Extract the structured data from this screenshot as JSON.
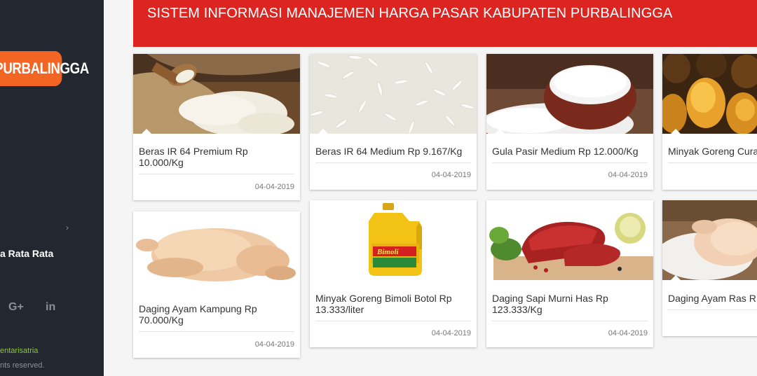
{
  "sidebar": {
    "logo_text": "PURBALINGGA",
    "chevron": "›",
    "menu_label": "a Rata Rata",
    "social_gplus": "G+",
    "social_linkedin": "in",
    "credit": "entarisatria",
    "rights": "nts reserved."
  },
  "header": {
    "title": "SISTEM INFORMASI MANAJEMEN HARGA PASAR KABUPATEN PURBALINGGA"
  },
  "colors": {
    "header_red": "#dc2520",
    "sidebar_dark": "#232830",
    "logo_orange": "#f26522"
  },
  "products": [
    {
      "title": "Beras IR 64 Premium Rp 10.000/Kg",
      "date": "04-04-2019",
      "image": "rice-sack-image"
    },
    {
      "title": "Beras IR 64 Medium Rp 9.167/Kg",
      "date": "04-04-2019",
      "image": "rice-grains-image"
    },
    {
      "title": "Gula Pasir Medium Rp 12.000/Kg",
      "date": "04-04-2019",
      "image": "sugar-bowl-image"
    },
    {
      "title": "Minyak Goreng Cura",
      "date": "",
      "image": "oil-packs-image"
    },
    {
      "title": "Daging Ayam Kampung Rp 70.000/Kg",
      "date": "04-04-2019",
      "image": "whole-chicken-image"
    },
    {
      "title": "Minyak Goreng Bimoli Botol Rp 13.333/liter",
      "date": "04-04-2019",
      "image": "bimoli-bottle-image",
      "bottle_label": "Bimoli"
    },
    {
      "title": "Daging Sapi Murni Has Rp 123.333/Kg",
      "date": "04-04-2019",
      "image": "beef-image"
    },
    {
      "title": "Daging Ayam Ras R",
      "date": "",
      "image": "chicken-ras-image"
    }
  ]
}
